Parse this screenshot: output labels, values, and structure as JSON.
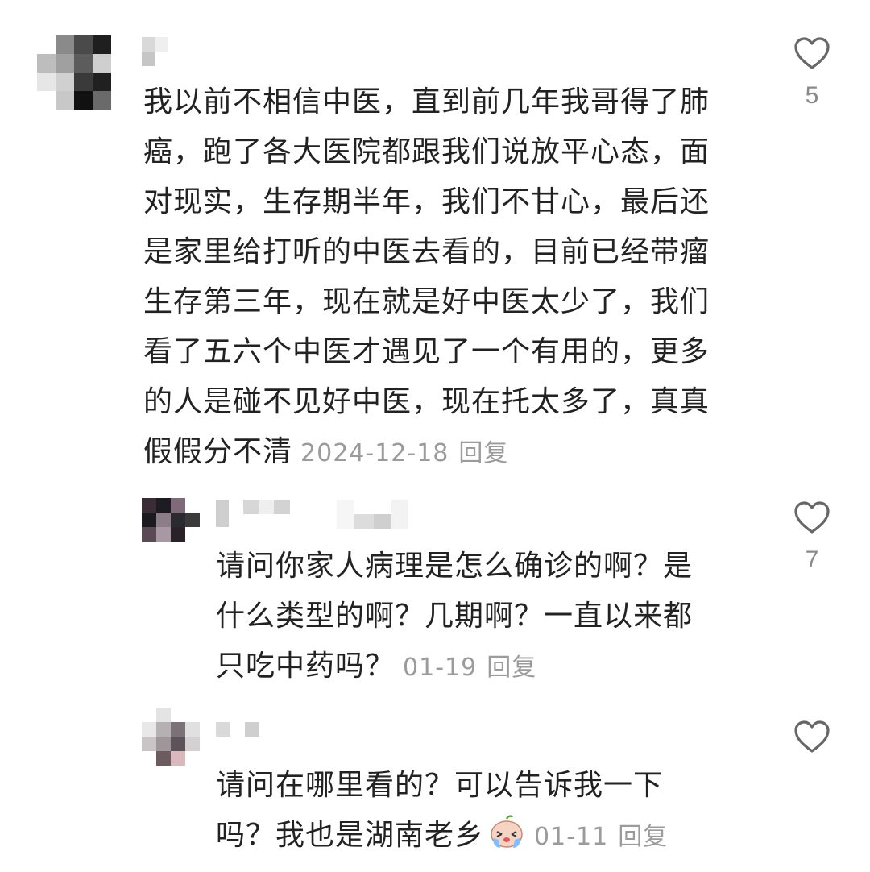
{
  "comments": [
    {
      "text_lines": [
        "我以前不相信中医，直到前几年我哥得了肺",
        "癌，跑了各大医院都跟我们说放平心态，面",
        "对现实，生存期半年，我们不甘心，最后还",
        "是家里给打听的中医去看的，目前已经带瘤",
        "生存第三年，现在就是好中医太少了，我们",
        "看了五六个中医才遇见了一个有用的，更多",
        "的人是碰不见好中医，现在托太多了，真真",
        "假假分不清"
      ],
      "date": "2024-12-18",
      "reply_label": "回复",
      "likes": "5",
      "like_icon": "heart-outline-icon"
    },
    {
      "text_lines": [
        "请问你家人病理是怎么确诊的啊？是",
        "什么类型的啊？几期啊？一直以来都",
        "只吃中药吗？"
      ],
      "date": "01-19",
      "reply_label": "回复",
      "likes": "7",
      "like_icon": "heart-outline-icon"
    },
    {
      "text_lines": [
        "请问在哪里看的？可以告诉我一下",
        "吗？我也是湖南老乡"
      ],
      "emoji": "crying-emoji-icon",
      "date": "01-11",
      "reply_label": "回复",
      "likes": "",
      "like_icon": "heart-outline-icon"
    }
  ],
  "colors": {
    "text": "#222222",
    "meta": "#9b9b9b",
    "icon": "#666666"
  }
}
